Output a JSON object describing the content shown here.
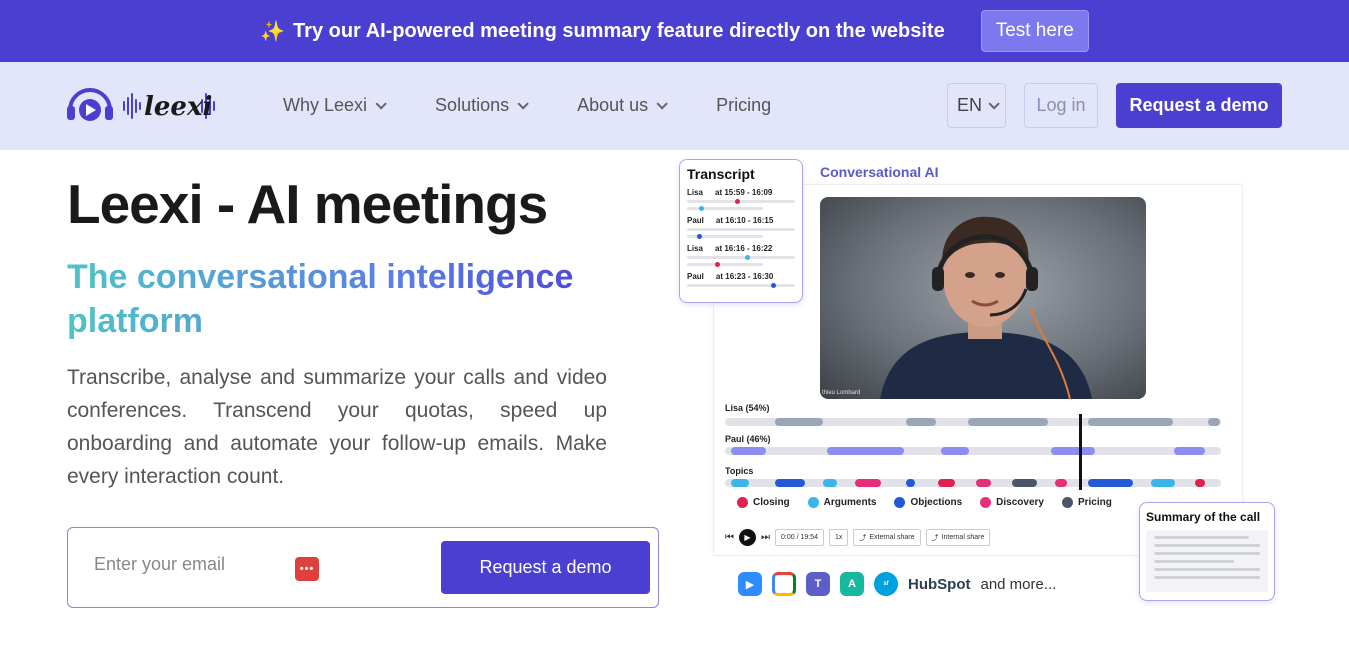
{
  "banner": {
    "text": "Try our AI-powered meeting summary feature directly on the website",
    "button": "Test here",
    "sparkle_icon": "sparkle-icon"
  },
  "nav": {
    "logo_text": "leexi",
    "links": [
      {
        "label": "Why Leexi",
        "dropdown": true
      },
      {
        "label": "Solutions",
        "dropdown": true
      },
      {
        "label": "About us",
        "dropdown": true
      },
      {
        "label": "Pricing",
        "dropdown": false
      }
    ],
    "language": "EN",
    "login": "Log in",
    "cta": "Request a demo"
  },
  "hero": {
    "title": "Leexi - AI meetings",
    "subtitle": "The conversational intelligence platform",
    "description": "Transcribe, analyse and summarize your calls and video conferences. Transcend your quotas, speed up onboarding and automate your follow-up emails. Make every interaction count.",
    "email_placeholder": "Enter your email",
    "cta": "Request a demo"
  },
  "demo": {
    "section_label": "Conversational AI",
    "video_caption": "thieu Lombard",
    "transcript": {
      "title": "Transcript",
      "rows": [
        {
          "speaker": "Lisa",
          "time": "at 15:59 - 16:09"
        },
        {
          "speaker": "Paul",
          "time": "at 16:10 - 16:15"
        },
        {
          "speaker": "Lisa",
          "time": "at 16:16 - 16:22"
        },
        {
          "speaker": "Paul",
          "time": "at 16:23 - 16:30"
        }
      ]
    },
    "speakers": [
      {
        "label": "Lisa (54%)"
      },
      {
        "label": "Paul (46%)"
      },
      {
        "label": "Topics"
      }
    ],
    "legend": [
      {
        "label": "Closing",
        "color": "#e0234e"
      },
      {
        "label": "Arguments",
        "color": "#3bb4ea"
      },
      {
        "label": "Objections",
        "color": "#2359d6"
      },
      {
        "label": "Discovery",
        "color": "#e62e7a"
      },
      {
        "label": "Pricing",
        "color": "#4a5568"
      }
    ],
    "controls": {
      "time": "0:00 / 19:54",
      "speed": "1x",
      "external_share": "External share",
      "internal_share": "Internal share"
    },
    "summary_title": "Summary of the call",
    "integrations": {
      "hubspot": "HubSpot",
      "more": "and more..."
    }
  },
  "colors": {
    "brand": "#4a3fd1",
    "nav_bg": "#e3e5fb",
    "lisa_track": "#9aa5b8",
    "paul_track": "#8b8ef0"
  }
}
